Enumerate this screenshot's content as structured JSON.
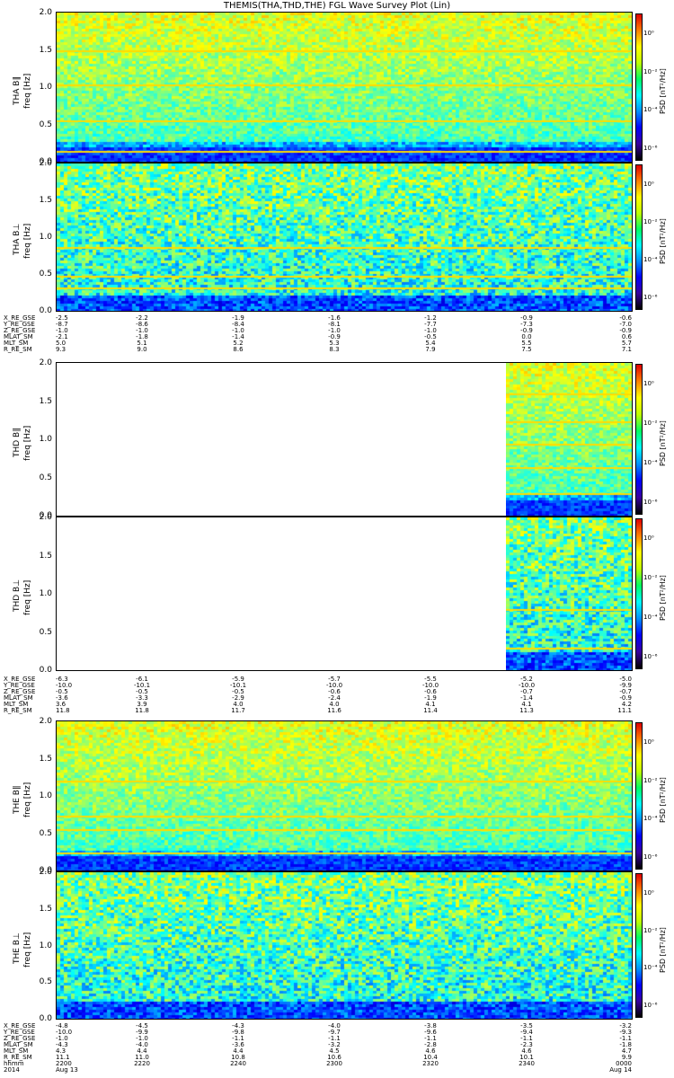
{
  "title": "THEMIS(THA,THD,THE) FGL Wave Survey Plot (Lin)",
  "colorbar": {
    "label": "PSD [nT²/Hz]",
    "tick_labels": [
      "10⁰",
      "10⁻²",
      "10⁻⁴",
      "10⁻⁶"
    ],
    "colors": [
      "#000000",
      "#3a00a0",
      "#0000ff",
      "#0090ff",
      "#00ffff",
      "#00ff60",
      "#c0ff00",
      "#ffff00",
      "#ff8000",
      "#e00000"
    ]
  },
  "groups": [
    {
      "panels": [
        {
          "name": "THA B∥",
          "ylabel_top": "THA B∥",
          "ylabel_bottom": "freq [Hz]",
          "yticks": [
            "0.0",
            "0.5",
            "1.0",
            "1.5",
            "2.0"
          ],
          "type": "parallel",
          "lines": [
            0.07,
            0.28,
            0.52,
            0.75,
            1.48
          ],
          "fill": "full"
        },
        {
          "name": "THA B⊥",
          "ylabel_top": "THA B⊥",
          "ylabel_bottom": "freq [Hz]",
          "yticks": [
            "0.0",
            "0.5",
            "1.0",
            "1.5",
            "2.0"
          ],
          "type": "perp",
          "lines": [
            0.16,
            0.24,
            0.43
          ],
          "fill": "full"
        }
      ],
      "ephemeris": {
        "names": [
          "X_RE_GSE",
          "Y_RE_GSE",
          "Z_RE_GSE",
          "MLAT_SM",
          "MLT_SM",
          "R_RE_SM"
        ],
        "values": [
          [
            "-2.5",
            "-2.2",
            "-1.9",
            "-1.6",
            "-1.2",
            "-0.9",
            "-0.6"
          ],
          [
            "-8.7",
            "-8.6",
            "-8.4",
            "-8.1",
            "-7.7",
            "-7.3",
            "-7.0"
          ],
          [
            "-1.0",
            "-1.0",
            "-1.0",
            "-1.0",
            "-1.0",
            "-0.9",
            "-0.9"
          ],
          [
            "-2.1",
            "-1.8",
            "-1.4",
            "-0.9",
            "-0.5",
            "0.0",
            "0.6"
          ],
          [
            "5.0",
            "5.1",
            "5.2",
            "5.3",
            "5.4",
            "5.5",
            "5.7"
          ],
          [
            "9.3",
            "9.0",
            "8.6",
            "8.3",
            "7.9",
            "7.5",
            "7.1"
          ]
        ]
      }
    },
    {
      "panels": [
        {
          "name": "THD B∥",
          "ylabel_top": "THD B∥",
          "ylabel_bottom": "freq [Hz]",
          "yticks": [
            "0.0",
            "0.5",
            "1.0",
            "1.5",
            "2.0"
          ],
          "type": "parallel",
          "lines": [
            0.15,
            0.32,
            0.47,
            0.62,
            0.8
          ],
          "fill": "tail"
        },
        {
          "name": "THD B⊥",
          "ylabel_top": "THD B⊥",
          "ylabel_bottom": "freq [Hz]",
          "yticks": [
            "0.0",
            "0.5",
            "1.0",
            "1.5",
            "2.0"
          ],
          "type": "perp",
          "lines": [
            0.15,
            0.4
          ],
          "fill": "tail"
        }
      ],
      "ephemeris": {
        "names": [
          "X_RE_GSE",
          "Y_RE_GSE",
          "Z_RE_GSE",
          "MLAT_SM",
          "MLT_SM",
          "R_RE_SM"
        ],
        "values": [
          [
            "-6.3",
            "-6.1",
            "-5.9",
            "-5.7",
            "-5.5",
            "-5.2",
            "-5.0"
          ],
          [
            "-10.0",
            "-10.1",
            "-10.1",
            "-10.0",
            "-10.0",
            "-10.0",
            "-9.9"
          ],
          [
            "-0.5",
            "-0.5",
            "-0.5",
            "-0.6",
            "-0.6",
            "-0.7",
            "-0.7"
          ],
          [
            "-3.6",
            "-3.3",
            "-2.9",
            "-2.4",
            "-1.9",
            "-1.4",
            "-0.9"
          ],
          [
            "3.6",
            "3.9",
            "4.0",
            "4.0",
            "4.1",
            "4.1",
            "4.2"
          ],
          [
            "11.8",
            "11.8",
            "11.7",
            "11.6",
            "11.4",
            "11.3",
            "11.1"
          ]
        ]
      }
    },
    {
      "panels": [
        {
          "name": "THE B∥",
          "ylabel_top": "THE B∥",
          "ylabel_bottom": "freq [Hz]",
          "yticks": [
            "0.0",
            "0.5",
            "1.0",
            "1.5",
            "2.0"
          ],
          "type": "parallel",
          "lines": [
            0.12,
            0.28,
            0.37,
            0.6
          ],
          "fill": "full"
        },
        {
          "name": "THE B⊥",
          "ylabel_top": "THE B⊥",
          "ylabel_bottom": "freq [Hz]",
          "yticks": [
            "0.0",
            "0.5",
            "1.0",
            "1.5",
            "2.0"
          ],
          "type": "perp",
          "lines": [],
          "fill": "full"
        }
      ],
      "ephemeris": {
        "names": [
          "X_RE_GSE",
          "Y_RE_GSE",
          "Z_RE_GSE",
          "MLAT_SM",
          "MLT_SM",
          "R_RE_SM",
          "hhmm",
          "2014"
        ],
        "values": [
          [
            "-4.8",
            "-4.5",
            "-4.3",
            "-4.0",
            "-3.8",
            "-3.5",
            "-3.2"
          ],
          [
            "-10.0",
            "-9.9",
            "-9.8",
            "-9.7",
            "-9.6",
            "-9.4",
            "-9.3"
          ],
          [
            "-1.0",
            "-1.0",
            "-1.1",
            "-1.1",
            "-1.1",
            "-1.1",
            "-1.1"
          ],
          [
            "-4.3",
            "-4.0",
            "-3.6",
            "-3.2",
            "-2.8",
            "-2.3",
            "-1.8"
          ],
          [
            "4.3",
            "4.4",
            "4.4",
            "4.5",
            "4.6",
            "4.6",
            "4.7"
          ],
          [
            "11.1",
            "11.0",
            "10.8",
            "10.6",
            "10.4",
            "10.1",
            "9.9"
          ],
          [
            "2200",
            "2220",
            "2240",
            "2300",
            "2320",
            "2340",
            "0000"
          ],
          [
            "Aug 13",
            "",
            "",
            "",
            "",
            "",
            "Aug 14"
          ]
        ]
      }
    }
  ],
  "chart_data": {
    "type": "heatmap",
    "title": "THEMIS(THA,THD,THE) FGL Wave Survey Plot (Lin)",
    "xlabel": "hhmm",
    "x_ticks": [
      "2200",
      "2220",
      "2240",
      "2300",
      "2320",
      "2340",
      "0000"
    ],
    "ylabel": "freq [Hz]",
    "ylim": [
      0,
      2
    ],
    "color_scale": "log",
    "color_label": "PSD [nT²/Hz]",
    "series": [
      {
        "name": "THA B∥"
      },
      {
        "name": "THA B⊥"
      },
      {
        "name": "THD B∥"
      },
      {
        "name": "THD B⊥"
      },
      {
        "name": "THE B∥"
      },
      {
        "name": "THE B⊥"
      }
    ]
  }
}
